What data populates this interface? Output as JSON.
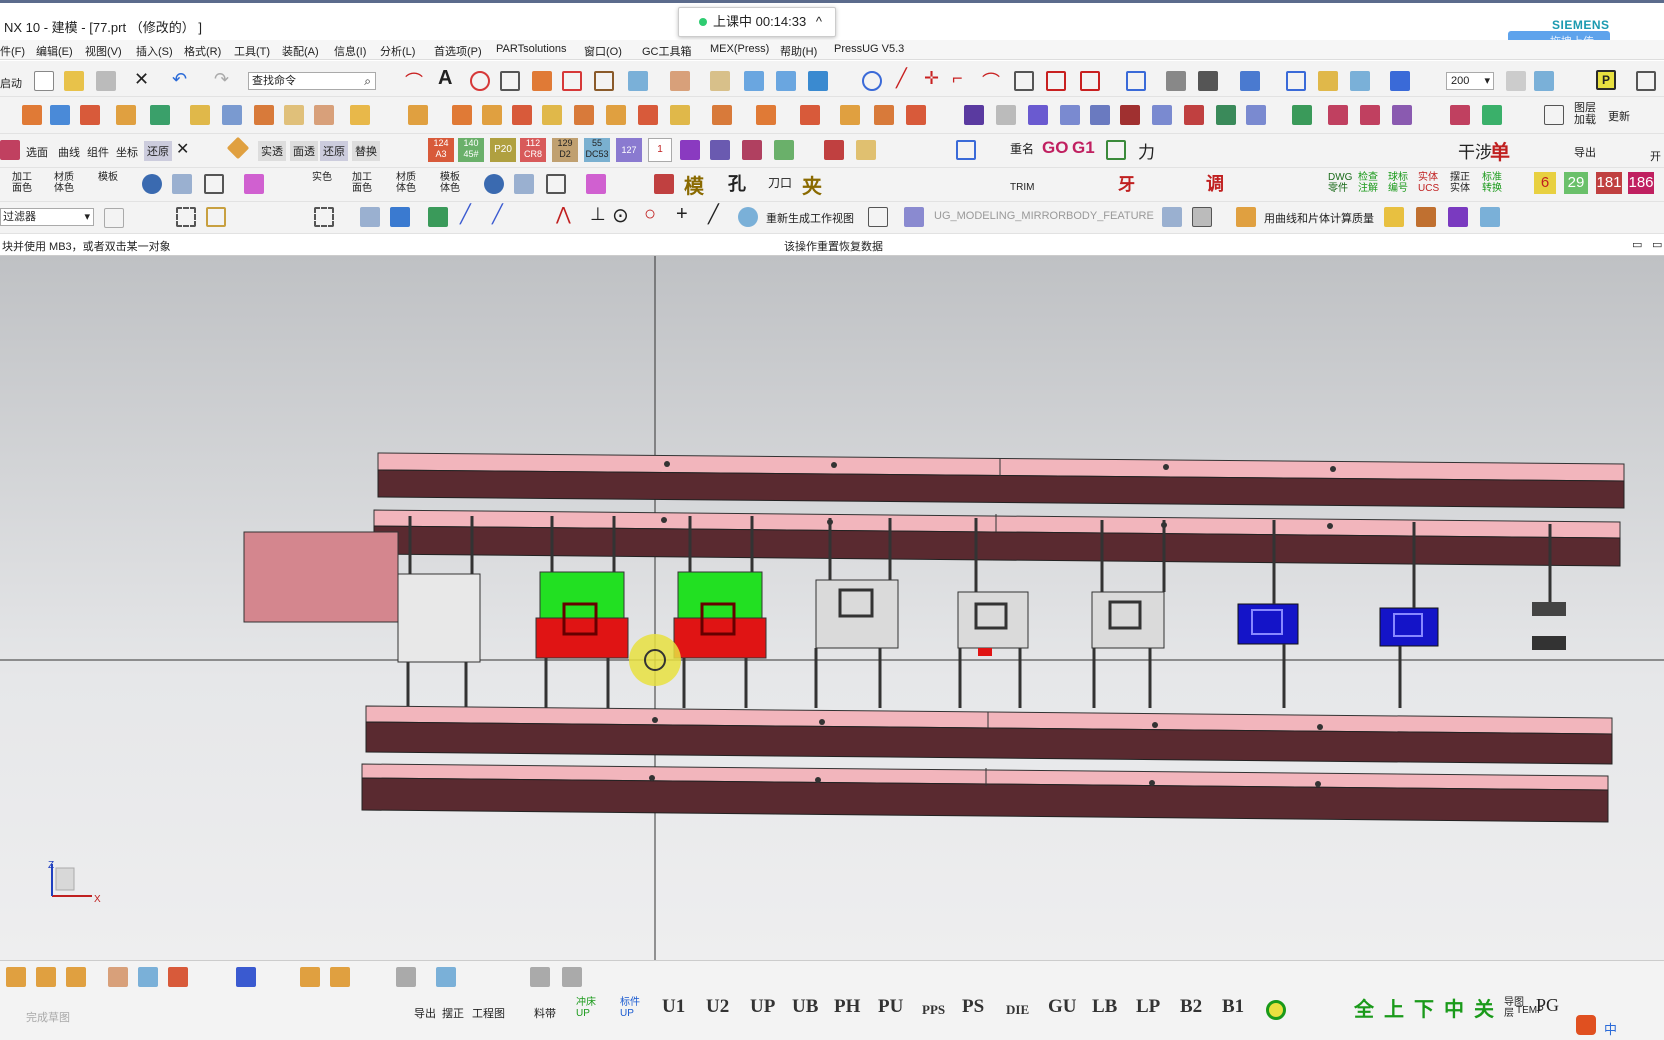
{
  "window": {
    "title": "NX 10 - 建模 - [77.prt （修改的） ]",
    "rec_status": "上课中 00:14:33",
    "rec_chevron": "^",
    "brand": "SIEMENS",
    "upload_label": "拖拽上传"
  },
  "menu": [
    "件(F)",
    "编辑(E)",
    "视图(V)",
    "插入(S)",
    "格式(R)",
    "工具(T)",
    "装配(A)",
    "信息(I)",
    "分析(L)",
    "首选项(P)",
    "PARTsolutions",
    "窗口(O)",
    "GC工具箱",
    "MEX(Press)",
    "帮助(H)",
    "PressUG V5.3"
  ],
  "toolbar": {
    "start": "启动",
    "search_placeholder": "查找命令",
    "zoom_value": "200",
    "layer_add": "图层加载",
    "update": "更新",
    "open": "开"
  },
  "row3": {
    "labels": [
      "选面",
      "曲线",
      "组件",
      "坐标",
      "还原",
      "实透",
      "面透",
      "还原",
      "替换"
    ],
    "chips": [
      "124 A3",
      "140 45#",
      "P20",
      "112 CR8",
      "129 D2",
      "55 DC53",
      "127",
      "1"
    ],
    "rename": "重名",
    "go": "GO",
    "g1": "G1",
    "force": "力",
    "single": "单",
    "export": "导出",
    "dry": "干涉"
  },
  "row4": {
    "labels": [
      "加工面色",
      "材质体色",
      "模板",
      "实色",
      "加工面色",
      "材质体色",
      "模板体色"
    ],
    "mold": "模",
    "hole": "孔",
    "blade": "刀口",
    "clamp": "夹",
    "trim": "TRIM",
    "tooth": "牙",
    "adjust": "调",
    "nums": [
      "6",
      "29",
      "181",
      "186"
    ],
    "right": [
      "DWG零件",
      "检查注解",
      "球标编号",
      "实体UCS",
      "摆正实体",
      "标准转换"
    ]
  },
  "row5": {
    "filter": "过滤器",
    "regen": "重新生成工作视图",
    "feature": "UG_MODELING_MIRRORBODY_FEATURE",
    "mass": "用曲线和片体计算质量"
  },
  "status": {
    "left": "块并使用 MB3，或者双击某一对象",
    "center": "该操作重置恢复数据"
  },
  "triad": {
    "z": "Z",
    "x": "X"
  },
  "bottom": {
    "done": "完成草图",
    "export": "导出",
    "align": "摆正",
    "drawing": "工程图",
    "strip": "料带",
    "punch": "冲床UP",
    "mark": "标件UP",
    "codes": [
      "U1",
      "U2",
      "UP",
      "UB",
      "PH",
      "PU",
      "PPS",
      "PS",
      "DIE",
      "GU",
      "LB",
      "LP",
      "B2",
      "B1"
    ],
    "temp": "TEMP",
    "chars": [
      "全",
      "上",
      "下",
      "中",
      "关"
    ],
    "guide": "导图层",
    "pg": "PG",
    "ime": "中"
  },
  "colors": {
    "bar_pink": "#f2b5bc",
    "bar_dark": "#5a2a30",
    "station_green": "#22e022",
    "station_red": "#e01414",
    "station_blue": "#1414c8",
    "accent": "#1a9ab0"
  }
}
